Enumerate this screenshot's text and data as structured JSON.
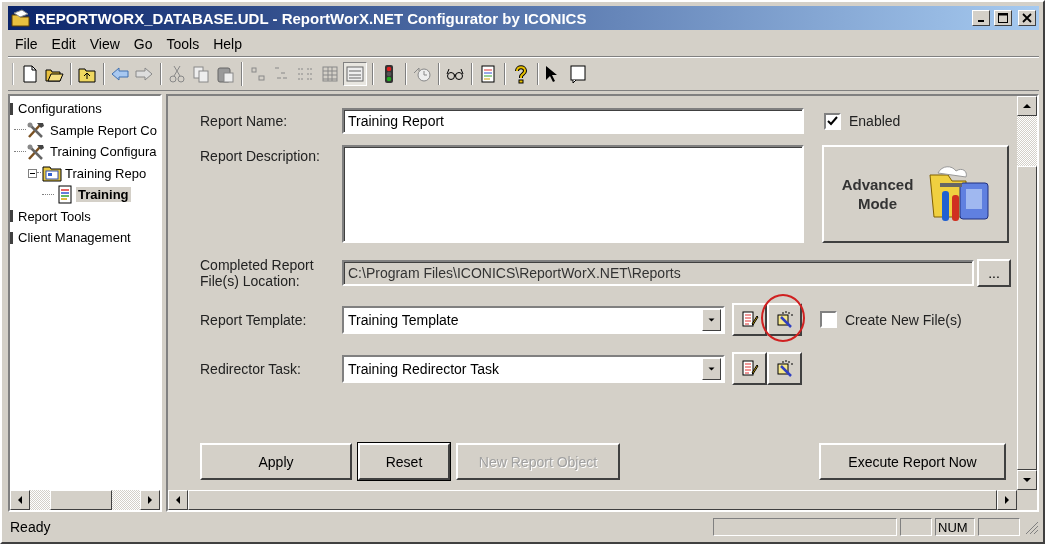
{
  "window": {
    "title": "REPORTWORX_DATABASE.UDL - ReportWorX.NET Configurator by ICONICS"
  },
  "menu": [
    "File",
    "Edit",
    "View",
    "Go",
    "Tools",
    "Help"
  ],
  "tree": [
    {
      "label": "Configurations",
      "kind": "category",
      "selected": false,
      "children": [
        {
          "label": "Sample Report Co",
          "kind": "config",
          "selected": false
        },
        {
          "label": "Training Configura",
          "kind": "config",
          "selected": false,
          "children": [
            {
              "label": "Training Repo",
              "kind": "report-group",
              "selected": false,
              "expanded": true,
              "children": [
                {
                  "label": "Training",
                  "kind": "report",
                  "selected": true
                }
              ]
            }
          ]
        }
      ]
    },
    {
      "label": "Report Tools",
      "kind": "category",
      "selected": false
    },
    {
      "label": "Client Management",
      "kind": "category",
      "selected": false
    }
  ],
  "form": {
    "report_name": {
      "label": "Report Name:",
      "value": "Training Report"
    },
    "enabled": {
      "label": "Enabled",
      "checked": true
    },
    "description": {
      "label": "Report Description:"
    },
    "advanced_mode": {
      "label": "Advanced Mode"
    },
    "location": {
      "label": "Completed Report File(s) Location:",
      "value": "C:\\Program Files\\ICONICS\\ReportWorX.NET\\Reports",
      "browse": "..."
    },
    "template": {
      "label": "Report Template:",
      "value": "Training Template"
    },
    "create_new_files": {
      "label": "Create New File(s)",
      "checked": false
    },
    "redirector": {
      "label": "Redirector Task:",
      "value": "Training Redirector Task"
    }
  },
  "buttons": [
    {
      "label": "Apply",
      "disabled": false
    },
    {
      "label": "Reset",
      "disabled": false
    },
    {
      "label": "New Report Object",
      "disabled": true
    },
    {
      "label": "Execute Report Now",
      "disabled": false
    }
  ],
  "status_bar": {
    "text": "Ready",
    "indicators": [
      "NUM"
    ]
  }
}
